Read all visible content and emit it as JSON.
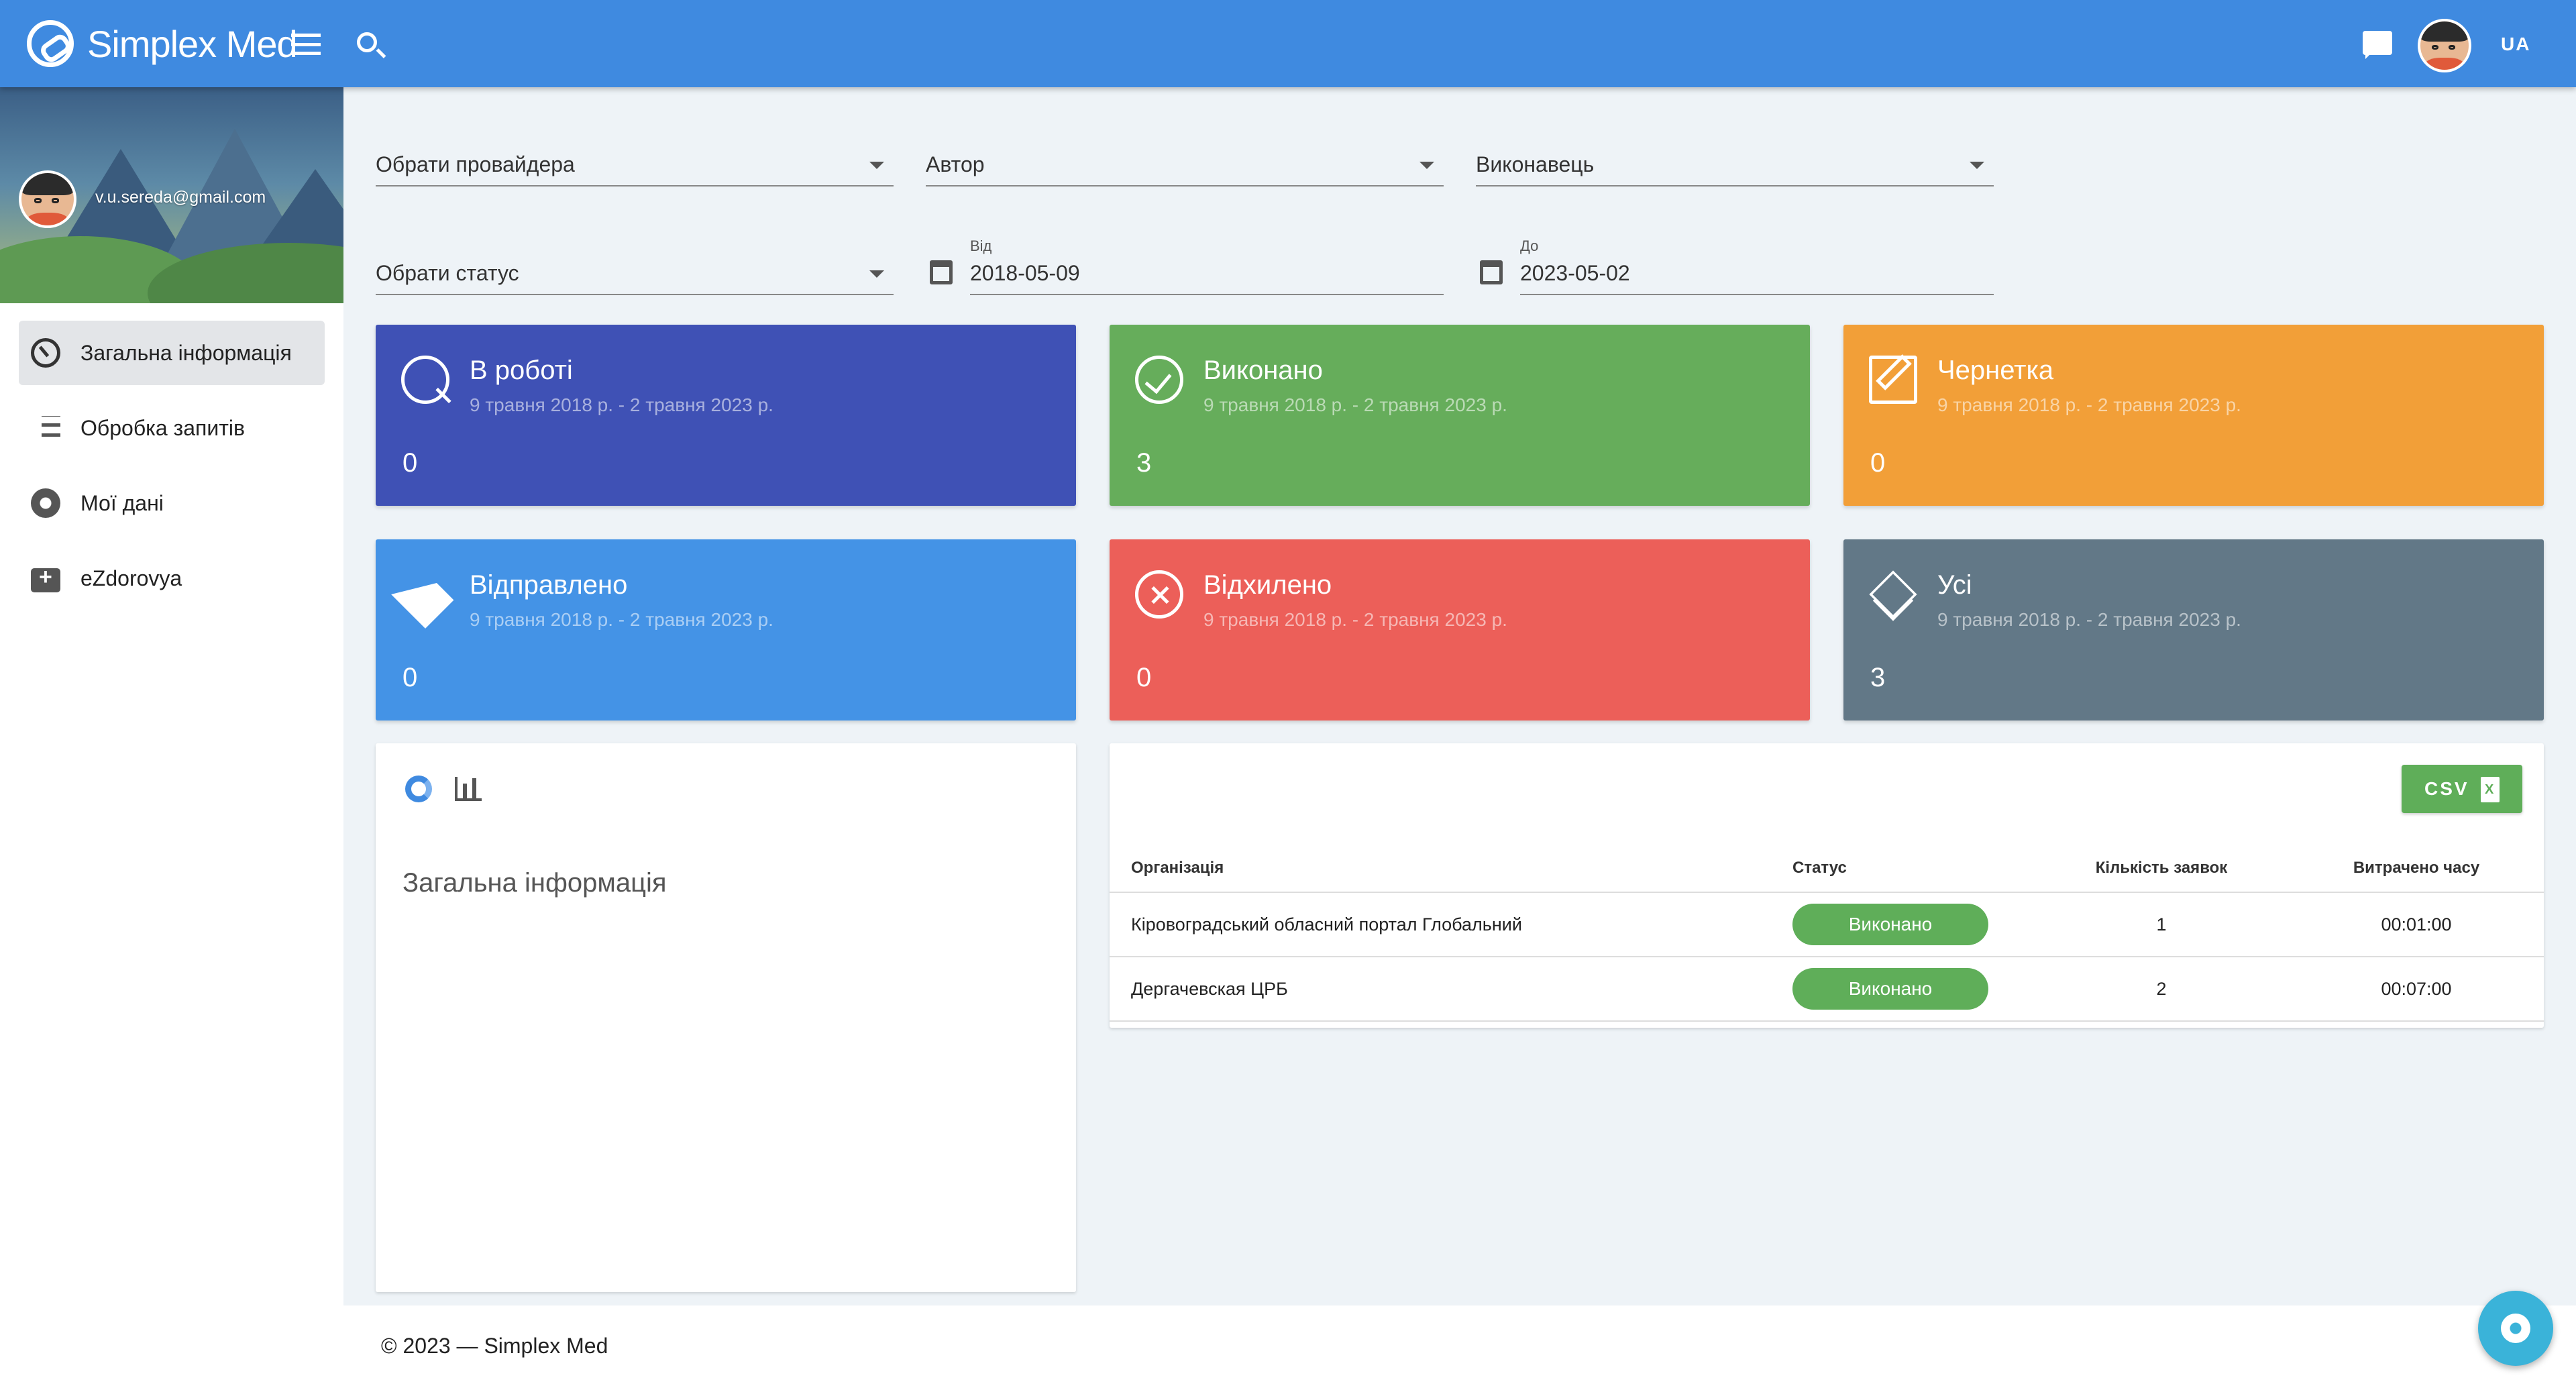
{
  "app": {
    "name": "Simplex Med",
    "lang": "UA"
  },
  "user": {
    "email": "v.u.sereda@gmail.com"
  },
  "sidebar": {
    "items": [
      {
        "label": "Загальна інформація",
        "icon": "dashboard-icon"
      },
      {
        "label": "Обробка запитів",
        "icon": "list-icon"
      },
      {
        "label": "Мої дані",
        "icon": "gear-icon"
      },
      {
        "label": "eZdorovya",
        "icon": "medical-kit-icon"
      }
    ]
  },
  "filters": {
    "provider": "Обрати провайдера",
    "author": "Автор",
    "executor": "Виконавець",
    "status": "Обрати статус",
    "from_label": "Від",
    "from_value": "2018-05-09",
    "to_label": "До",
    "to_value": "2023-05-02"
  },
  "cards": [
    {
      "title": "В роботі",
      "period": "9 травня 2018 р. - 2 травня 2023 р.",
      "count": "0",
      "color": "#3f51b5"
    },
    {
      "title": "Виконано",
      "period": "9 травня 2018 р. - 2 травня 2023 р.",
      "count": "3",
      "color": "#66ad5b"
    },
    {
      "title": "Чернетка",
      "period": "9 травня 2018 р. - 2 травня 2023 р.",
      "count": "0",
      "color": "#f29f38"
    },
    {
      "title": "Відправлено",
      "period": "9 травня 2018 р. - 2 травня 2023 р.",
      "count": "0",
      "color": "#4493e6"
    },
    {
      "title": "Відхилено",
      "period": "9 травня 2018 р. - 2 травня 2023 р.",
      "count": "0",
      "color": "#ec5f59"
    },
    {
      "title": "Усі",
      "period": "9 травня 2018 р. - 2 травня 2023 р.",
      "count": "3",
      "color": "#627887"
    }
  ],
  "overview": {
    "title": "Загальна інформація"
  },
  "table": {
    "csv_label": "CSV",
    "headers": [
      "Організація",
      "Статус",
      "Кількість заявок",
      "Витрачено часу"
    ],
    "rows": [
      [
        "Кіровоградський обласний портал Глобальний",
        "Виконано",
        "1",
        "00:01:00"
      ],
      [
        "Дергачевская ЦРБ",
        "Виконано",
        "2",
        "00:07:00"
      ]
    ]
  },
  "footer": {
    "text": "© 2023 — Simplex Med"
  }
}
